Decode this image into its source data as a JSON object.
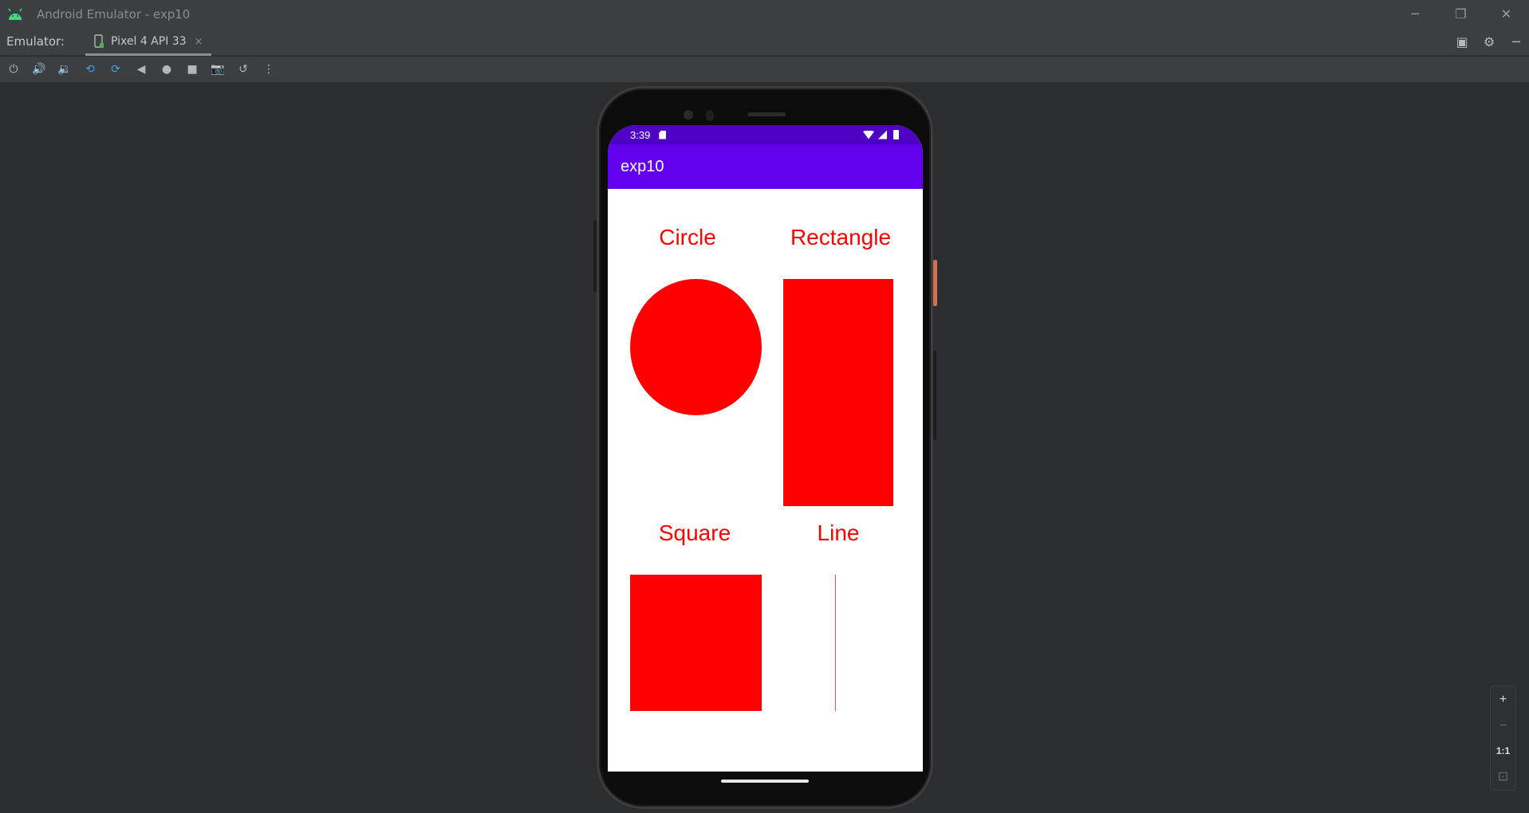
{
  "window": {
    "title": "Android Emulator - exp10",
    "minimize_icon": "─",
    "restore_icon": "❐",
    "close_icon": "✕"
  },
  "tabbar": {
    "label": "Emulator:",
    "tab_label": "Pixel 4 API 33",
    "tab_close": "×",
    "right_icons": [
      "▣",
      "⚙",
      "─"
    ]
  },
  "toolbar": {
    "icons": [
      "⏻",
      "🔊",
      "🔉",
      "⟲",
      "⟳",
      "◀",
      "●",
      "■",
      "📷",
      "↺",
      "⋮"
    ]
  },
  "device": {
    "status": {
      "time": "3:39"
    },
    "app_title": "exp10",
    "shapes": {
      "circle_label": "Circle",
      "rectangle_label": "Rectangle",
      "square_label": "Square",
      "line_label": "Line",
      "color": "#ff0000"
    }
  },
  "zoom": {
    "zoom_in": "+",
    "zoom_out": "−",
    "one_to_one": "1:1",
    "fit": "⊡"
  },
  "colors": {
    "status_bar": "#4e02c4",
    "app_bar": "#6200ee",
    "shape": "#ff0000"
  }
}
